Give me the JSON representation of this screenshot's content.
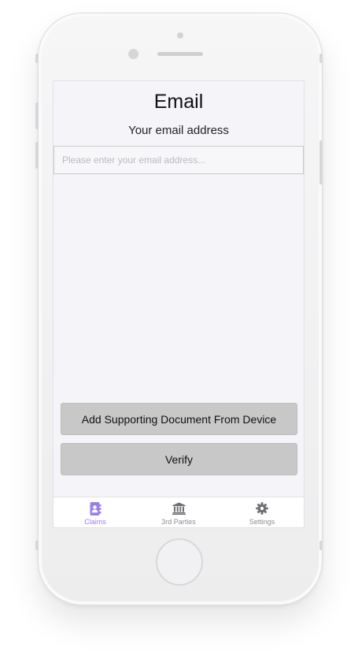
{
  "screen": {
    "title": "Email",
    "subtitle": "Your email address",
    "email_input": {
      "value": "",
      "placeholder": "Please enter your email address..."
    },
    "buttons": {
      "add_document": "Add Supporting Document From Device",
      "verify": "Verify"
    }
  },
  "tabbar": {
    "items": [
      {
        "label": "Claims",
        "icon": "address-book-icon",
        "active": true
      },
      {
        "label": "3rd Parties",
        "icon": "bank-icon",
        "active": false
      },
      {
        "label": "Settings",
        "icon": "gear-icon",
        "active": false
      }
    ]
  },
  "colors": {
    "accent": "#9b7fe6",
    "inactive": "#8e8e93",
    "button_bg": "#c8c8c8",
    "screen_bg": "#f5f5f9"
  }
}
